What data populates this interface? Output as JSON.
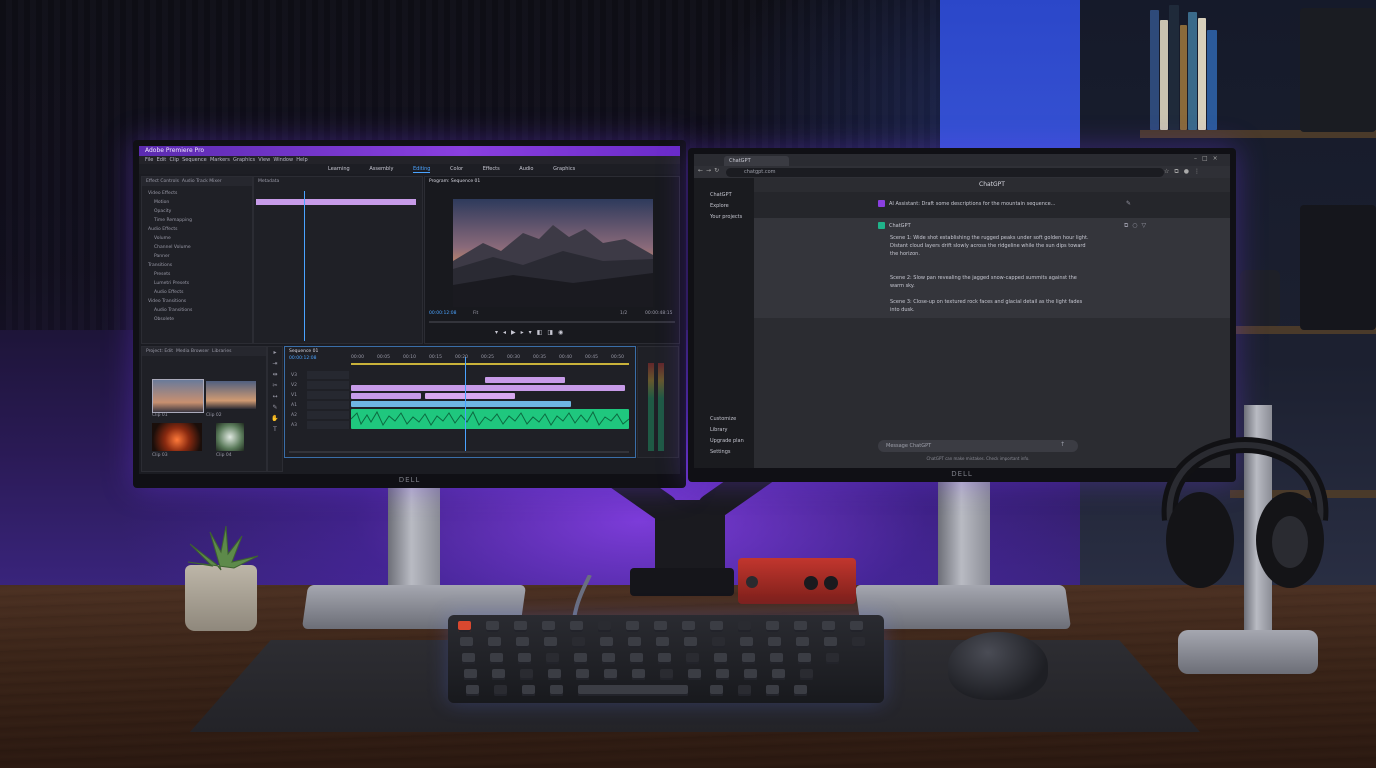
{
  "left_monitor": {
    "brand": "DELL",
    "app": {
      "title_bar": "Adobe Premiere Pro",
      "menu": [
        "File",
        "Edit",
        "Clip",
        "Sequence",
        "Markers",
        "Graphics",
        "View",
        "Window",
        "Help"
      ],
      "workspace_tabs": [
        "Learning",
        "Assembly",
        "Editing",
        "Color",
        "Effects",
        "Audio",
        "Graphics"
      ],
      "active_tab": "Editing",
      "source_panel_tabs": [
        "Effect Controls",
        "Audio Track Mixer",
        "Metadata"
      ],
      "source_tree": [
        "Video Effects",
        "Motion",
        "Opacity",
        "Time Remapping",
        "Audio Effects",
        "Volume",
        "Channel Volume",
        "Panner",
        "Transitions",
        "Presets",
        "Lumetri Presets",
        "Audio Effects",
        "Video Transitions",
        "Audio Transitions",
        "Obsolete"
      ],
      "program_panel_title": "Program: Sequence 01",
      "program_timecode_left": "00:00:12:08",
      "program_zoom": "Fit",
      "program_fraction": "1/2",
      "program_timecode_right": "00:00:48:15",
      "project_tabs": [
        "Project: Edit",
        "Media Browser",
        "Libraries"
      ],
      "project_bins": [
        "Clip 01",
        "Clip 02",
        "Clip 03",
        "Clip 04"
      ],
      "timeline_title": "Sequence 01",
      "timeline_timecode": "00:00:12:08",
      "ruler_ticks": [
        "00:00",
        "00:05",
        "00:10",
        "00:15",
        "00:20",
        "00:25",
        "00:30",
        "00:35",
        "00:40",
        "00:45",
        "00:50"
      ],
      "track_labels": [
        "V3",
        "V2",
        "V1",
        "A1",
        "A2",
        "A3"
      ],
      "colors": {
        "accent": "#8a3fe0",
        "playhead": "#4aa3ff",
        "video_clip": "#c79be8",
        "clip_blue": "#6fb6e3",
        "audio_clip": "#1fc77e"
      }
    }
  },
  "right_monitor": {
    "brand": "DELL",
    "browser": {
      "address": "chatgpt.com",
      "page_title": "ChatGPT",
      "sidebar_top": [
        "ChatGPT",
        "Explore",
        "Your projects"
      ],
      "sidebar_bottom": [
        "Customize",
        "Library",
        "Upgrade plan",
        "Settings"
      ],
      "user_prompt": "AI Assistant: Draft some descriptions for the mountain sequence...",
      "assistant_name": "ChatGPT",
      "assistant_paragraphs": [
        "Scene 1: Wide shot establishing the rugged peaks under soft golden hour light. Distant cloud layers drift slowly across the ridgeline while the sun dips toward the horizon.",
        "Scene 2: Slow pan revealing the jagged snow-capped summits against the warm sky.",
        "Scene 3: Close-up on textured rock faces and glacial detail as the light fades into dusk."
      ],
      "input_placeholder": "Message ChatGPT",
      "footer_note": "ChatGPT can make mistakes. Check important info."
    }
  },
  "desk_items": [
    "plant",
    "keyboard",
    "mouse",
    "audio-interface",
    "headphones",
    "monitor-arm"
  ]
}
